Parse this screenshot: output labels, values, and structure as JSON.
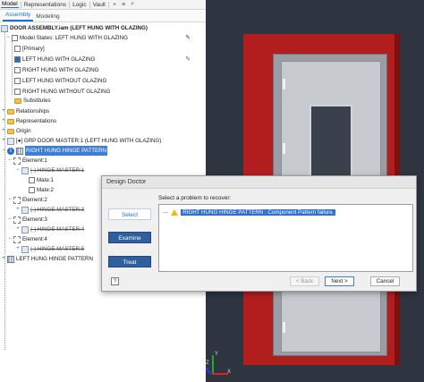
{
  "top_tabs": [
    "Model",
    "Representations",
    "Logic",
    "Vault"
  ],
  "top_tools": [
    "+",
    "≡",
    "⌕"
  ],
  "sub_tabs": [
    "Assembly",
    "Modeling"
  ],
  "tree": {
    "root": "DOOR ASSEMBLY.iam (LEFT HUNG WITH GLAZING)",
    "model_states": "Model States: LEFT HUNG WITH GLAZING",
    "primary": "[Primary]",
    "state_left_hung_glazing": "LEFT HUNG WITH GLAZING",
    "state_right_hung_glazing": "RIGHT HUNG WITH GLAZING",
    "state_left_hung_no_glazing": "LEFT HUNG WITHOUT GLAZING",
    "state_right_hung_no_glazing": "RIGHT HUNG WITHOUT GLAZING",
    "substitutes": "Substitutes",
    "relationships": "Relationships",
    "representations": "Representations",
    "origin": "Origin",
    "grp_door_master": "[●] GRP DOOR MASTER:1 (LEFT HUNG WITH GLAZING)",
    "right_hinge_pattern": "RIGHT HUNG HINGE PATTERN",
    "element1": "Element:1",
    "hinge_master1": "(-) HINGE MASTER:1",
    "mate1": "Mate:1",
    "mate2": "Mate:2",
    "element2": "Element:2",
    "hinge_master3": "(-) HINGE MASTER:3",
    "element3": "Element:3",
    "hinge_master4": "(-) HINGE MASTER:4",
    "element4": "Element:4",
    "hinge_master5": "(-) HINGE MASTER:5",
    "left_hinge_pattern": "LEFT HUNG HINGE PATTERN"
  },
  "dialog": {
    "title": "Design Doctor",
    "prompt": "Select a problem to recover:",
    "problem": "RIGHT HUNG HINGE PATTERN : Component Pattern failure.",
    "steps": [
      "Select",
      "Examine",
      "Treat"
    ],
    "back": "< Back",
    "next": "Next >",
    "cancel": "Cancel",
    "help": "?"
  },
  "triad": {
    "x": "X",
    "y": "Y",
    "z": "Z"
  },
  "colors": {
    "accent": "#1e6fd0",
    "frame": "#b21e1e",
    "viewport_bg": "#2e3440",
    "warning": "#f1b90f"
  }
}
